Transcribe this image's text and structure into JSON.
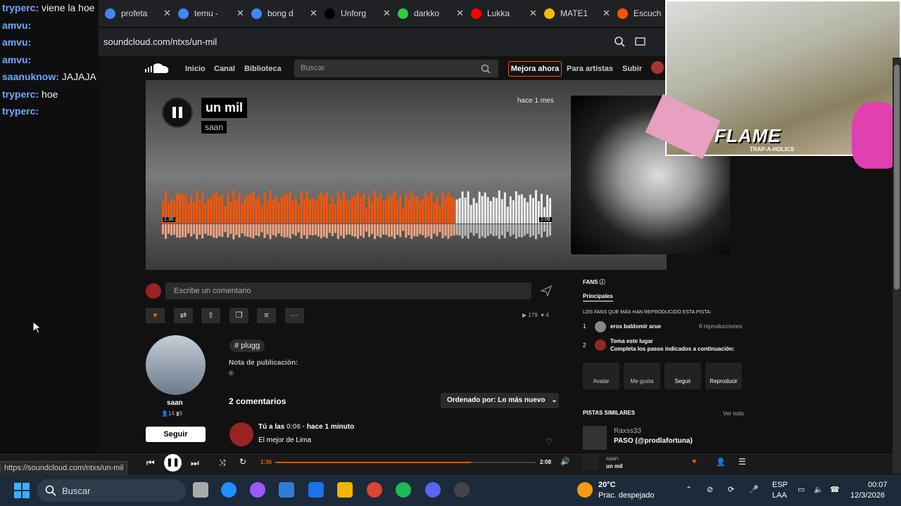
{
  "browser": {
    "tabs": [
      {
        "label": "Escuch",
        "color": "#e33"
      },
      {
        "label": "profeta",
        "color": "#4285f4"
      },
      {
        "label": "temu -",
        "color": "#4285f4"
      },
      {
        "label": "bong d",
        "color": "#4285f4"
      },
      {
        "label": "Unforg",
        "color": "#000"
      },
      {
        "label": "darkko",
        "color": "#2ecc40"
      },
      {
        "label": "Lukka",
        "color": "#f00"
      },
      {
        "label": "MATE1",
        "color": "#fbbc05"
      },
      {
        "label": "Escuch",
        "color": "#f50"
      }
    ],
    "url": "soundcloud.com/ntxs/un-mil",
    "status_url": "https://soundcloud.com/ntxs/un-mil"
  },
  "chat": {
    "lines": [
      {
        "user": "tryperc:",
        "msg": "viene la hoe"
      },
      {
        "user": "amvu:",
        "msg": ""
      },
      {
        "user": "amvu:",
        "msg": ""
      },
      {
        "user": "amvu:",
        "msg": ""
      },
      {
        "user": "saanuknow:",
        "msg": "JAJAJA"
      },
      {
        "user": "tryperc:",
        "msg": "hoe"
      },
      {
        "user": "tryperc:",
        "msg": ""
      }
    ]
  },
  "header": {
    "home": "Inicio",
    "feed": "Canal",
    "library": "Biblioteca",
    "search_placeholder": "Buscar",
    "upgrade": "Mejora ahora",
    "for_artists": "Para artistas",
    "upload": "Subir"
  },
  "track": {
    "title": "un mil",
    "artist": "saan",
    "posted": "hace 1 mes",
    "time_current": "1:36",
    "time_total": "2:08",
    "progress": 0.75
  },
  "overlay": {
    "flame": "FLAME",
    "flame_sub": "TRAP-A-HOLICS"
  },
  "comments": {
    "placeholder": "Escribe un comentario",
    "plays": "179",
    "likes": "4",
    "tag": "# plugg",
    "note_label": "Nota de publicación:",
    "note_value": "®",
    "count_title": "2 comentarios",
    "sort": "Ordenado por: Lo más nuevo",
    "first_author": "Tú a las",
    "first_time": "0:06",
    "first_ago": "· hace 1 minuto",
    "first_text": "El mejor de Lima"
  },
  "uploader": {
    "name": "saan",
    "followers": "14",
    "tracks": "9",
    "follow": "Seguir"
  },
  "fans": {
    "title": "FANS",
    "tab": "Principales",
    "subtitle": "LOS FANS QUE MÁS HAN REPRODUCIDO ESTA PISTA:",
    "rank1": "1",
    "fan1": "eros baldomir arue",
    "plays1": "8 reproducciones",
    "rank2": "2",
    "fan2_title": "Toma este lugar",
    "fan2_desc": "Completa los pasos indicados a continuación:",
    "actions": [
      "Avatar",
      "Me gusta",
      "Seguir",
      "Reproducir"
    ]
  },
  "similar": {
    "title": "PISTAS SIMILARES",
    "see_all": "Ver todo",
    "artist": "Raxss33",
    "track": "PASO (@prodlafortuna)"
  },
  "player": {
    "time_current": "1:36",
    "time_total": "2:08",
    "artist": "saan",
    "title": "un mil"
  },
  "taskbar": {
    "search": "Buscar",
    "weather_temp": "20°C",
    "weather_desc": "Prac. despejado",
    "lang1": "ESP",
    "lang2": "LAA",
    "time": "00:07",
    "date": "12/3/2026"
  },
  "colors": {
    "accent": "#ff5500",
    "link": "#6fa8ff"
  }
}
